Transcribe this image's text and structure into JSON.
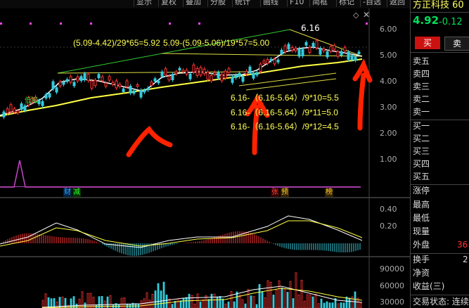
{
  "toolbar": {
    "items": [
      "显示",
      "复权",
      "叠加",
      "分股",
      "统计",
      "画线",
      "F10",
      "简框",
      "标记",
      "-自选",
      "返回"
    ]
  },
  "stock": {
    "name": "方正科技",
    "code_partial": "60",
    "price": "4.92",
    "change": "-0.12",
    "price_color": "#00e05a"
  },
  "trade": {
    "buy_label": "买",
    "sell_label": "卖"
  },
  "orderbook": {
    "sell": [
      "卖五",
      "卖四",
      "卖三",
      "卖二",
      "卖一"
    ],
    "buy": [
      "买一",
      "买二",
      "买三",
      "买四",
      "买五"
    ]
  },
  "stats": {
    "items": [
      "涨停",
      "最高",
      "最低",
      "现量",
      "外盘"
    ],
    "outer_value": "36"
  },
  "bottom_stats": {
    "turnover_label": "换手",
    "turnover_value": "2",
    "nav_label": "净资",
    "eps_label": "收益(三)",
    "status_label": "交易状态: 连续"
  },
  "main_axis": {
    "ticks": [
      "6.00",
      "5.00",
      "4.00",
      "3.00",
      "2.00",
      "1.00"
    ]
  },
  "macd_axis": {
    "ticks": [
      "0.40",
      "0.20"
    ]
  },
  "volume_axis": {
    "ticks": [
      "90000",
      "60000",
      "30000"
    ]
  },
  "annotations": {
    "peak": "6.16",
    "formula_a": "(5.09-4.42)/29*65=5.92",
    "formula_b": "5.09-(5.09-5.06)/19*57=5.00",
    "formula_c": "6.16-（6.16-5.64）/9*10=5.5",
    "formula_d": "6.16-（6.16-5.64）/9*11=5.0",
    "formula_e": "6.16-（6.16-5.64）/9*12=4.5",
    "low_tag": "低吸"
  },
  "event_tags": {
    "cai": "财",
    "jian": "减",
    "zhang": "张",
    "yu": "预",
    "bang": "榜"
  },
  "colors": {
    "up": "#ff3333",
    "down": "#33ccdd",
    "ma_white": "#ffffff",
    "ma_yellow": "#ffff44",
    "ma_green": "#33cc33",
    "handdrawn": "#ff2200"
  }
}
